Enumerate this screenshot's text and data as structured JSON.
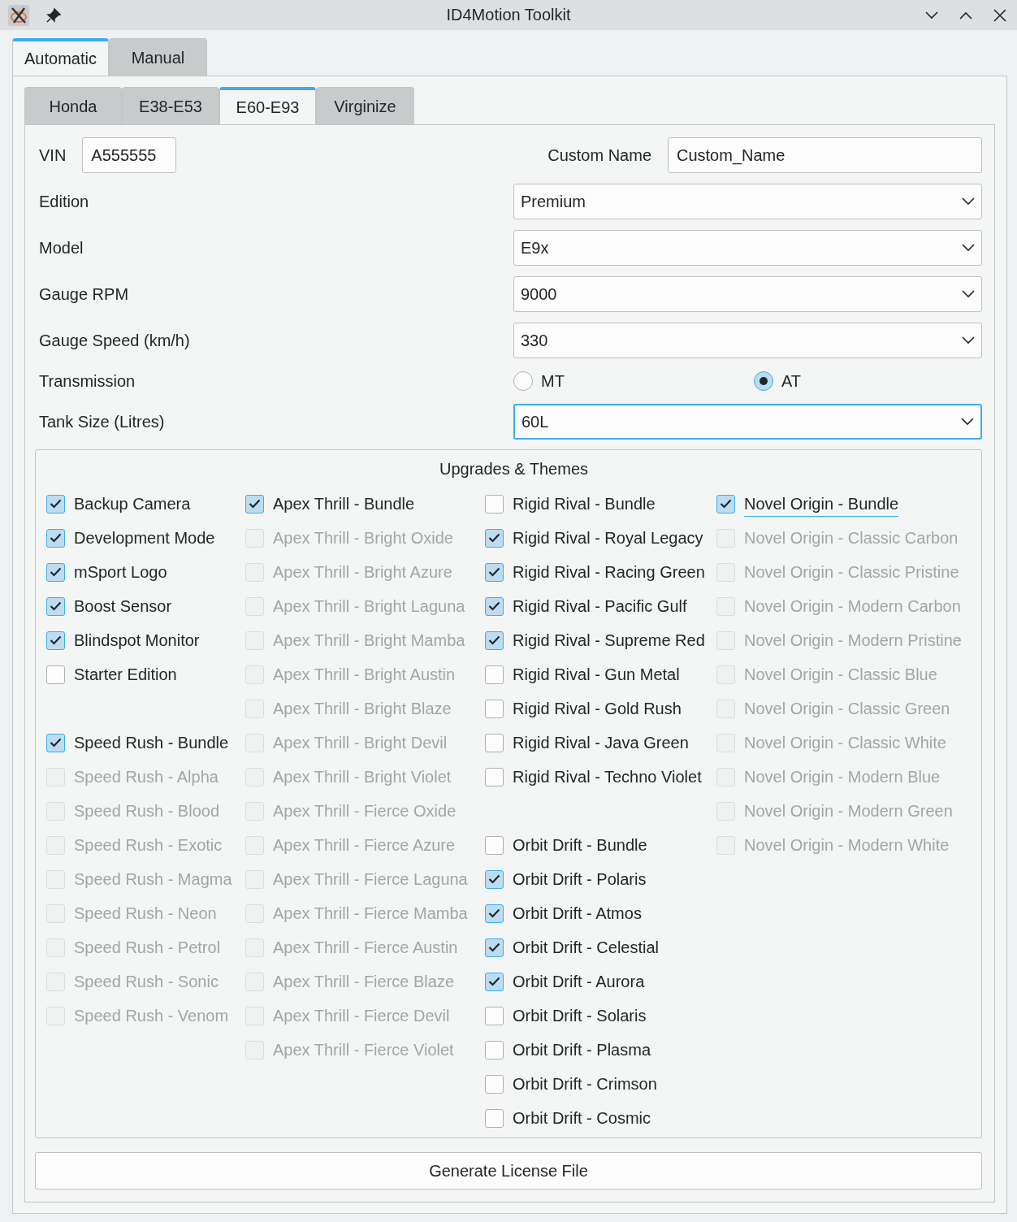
{
  "window": {
    "title": "ID4Motion Toolkit"
  },
  "top_tabs": [
    {
      "label": "Automatic",
      "selected": true
    },
    {
      "label": "Manual",
      "selected": false
    }
  ],
  "sub_tabs": [
    {
      "label": "Honda",
      "selected": false
    },
    {
      "label": "E38-E53",
      "selected": false
    },
    {
      "label": "E60-E93",
      "selected": true
    },
    {
      "label": "Virginize",
      "selected": false
    }
  ],
  "vin": {
    "label": "VIN",
    "value": "A555555"
  },
  "custom_name": {
    "label": "Custom Name",
    "value": "Custom_Name"
  },
  "form_rows": [
    {
      "kind": "combo",
      "label": "Edition",
      "value": "Premium",
      "focused": false
    },
    {
      "kind": "combo",
      "label": "Model",
      "value": "E9x",
      "focused": false
    },
    {
      "kind": "combo",
      "label": "Gauge RPM",
      "value": "9000",
      "focused": false
    },
    {
      "kind": "combo",
      "label": "Gauge Speed (km/h)",
      "value": "330",
      "focused": false
    },
    {
      "kind": "radio",
      "label": "Transmission",
      "options": [
        {
          "label": "MT",
          "selected": false
        },
        {
          "label": "AT",
          "selected": true
        }
      ]
    },
    {
      "kind": "combo",
      "label": "Tank Size (Litres)",
      "value": "60L",
      "focused": true
    }
  ],
  "upgrades": {
    "title": "Upgrades & Themes",
    "columns": [
      [
        {
          "kind": "checkbox",
          "label": "Backup Camera",
          "checked": true,
          "disabled": false
        },
        {
          "kind": "checkbox",
          "label": "Development Mode",
          "checked": true,
          "disabled": false
        },
        {
          "kind": "checkbox",
          "label": "mSport Logo",
          "checked": true,
          "disabled": false
        },
        {
          "kind": "checkbox",
          "label": "Boost Sensor",
          "checked": true,
          "disabled": false
        },
        {
          "kind": "checkbox",
          "label": "Blindspot Monitor",
          "checked": true,
          "disabled": false
        },
        {
          "kind": "checkbox",
          "label": "Starter Edition",
          "checked": false,
          "disabled": false
        },
        {
          "kind": "gap"
        },
        {
          "kind": "checkbox",
          "label": "Speed Rush - Bundle",
          "checked": true,
          "disabled": false
        },
        {
          "kind": "checkbox",
          "label": "Speed Rush - Alpha",
          "checked": false,
          "disabled": true
        },
        {
          "kind": "checkbox",
          "label": "Speed Rush - Blood",
          "checked": false,
          "disabled": true
        },
        {
          "kind": "checkbox",
          "label": "Speed Rush - Exotic",
          "checked": false,
          "disabled": true
        },
        {
          "kind": "checkbox",
          "label": "Speed Rush - Magma",
          "checked": false,
          "disabled": true
        },
        {
          "kind": "checkbox",
          "label": "Speed Rush - Neon",
          "checked": false,
          "disabled": true
        },
        {
          "kind": "checkbox",
          "label": "Speed Rush - Petrol",
          "checked": false,
          "disabled": true
        },
        {
          "kind": "checkbox",
          "label": "Speed Rush - Sonic",
          "checked": false,
          "disabled": true
        },
        {
          "kind": "checkbox",
          "label": "Speed Rush - Venom",
          "checked": false,
          "disabled": true
        }
      ],
      [
        {
          "kind": "checkbox",
          "label": "Apex Thrill - Bundle",
          "checked": true,
          "disabled": false
        },
        {
          "kind": "checkbox",
          "label": "Apex Thrill - Bright Oxide",
          "checked": false,
          "disabled": true
        },
        {
          "kind": "checkbox",
          "label": "Apex Thrill - Bright Azure",
          "checked": false,
          "disabled": true
        },
        {
          "kind": "checkbox",
          "label": "Apex Thrill - Bright Laguna",
          "checked": false,
          "disabled": true
        },
        {
          "kind": "checkbox",
          "label": "Apex Thrill - Bright Mamba",
          "checked": false,
          "disabled": true
        },
        {
          "kind": "checkbox",
          "label": "Apex Thrill - Bright Austin",
          "checked": false,
          "disabled": true
        },
        {
          "kind": "checkbox",
          "label": "Apex Thrill - Bright Blaze",
          "checked": false,
          "disabled": true
        },
        {
          "kind": "checkbox",
          "label": "Apex Thrill - Bright Devil",
          "checked": false,
          "disabled": true
        },
        {
          "kind": "checkbox",
          "label": "Apex Thrill - Bright Violet",
          "checked": false,
          "disabled": true
        },
        {
          "kind": "checkbox",
          "label": "Apex Thrill - Fierce Oxide",
          "checked": false,
          "disabled": true
        },
        {
          "kind": "checkbox",
          "label": "Apex Thrill - Fierce Azure",
          "checked": false,
          "disabled": true
        },
        {
          "kind": "checkbox",
          "label": "Apex Thrill - Fierce Laguna",
          "checked": false,
          "disabled": true
        },
        {
          "kind": "checkbox",
          "label": "Apex Thrill - Fierce Mamba",
          "checked": false,
          "disabled": true
        },
        {
          "kind": "checkbox",
          "label": "Apex Thrill - Fierce Austin",
          "checked": false,
          "disabled": true
        },
        {
          "kind": "checkbox",
          "label": "Apex Thrill - Fierce Blaze",
          "checked": false,
          "disabled": true
        },
        {
          "kind": "checkbox",
          "label": "Apex Thrill - Fierce Devil",
          "checked": false,
          "disabled": true
        },
        {
          "kind": "checkbox",
          "label": "Apex Thrill - Fierce Violet",
          "checked": false,
          "disabled": true
        }
      ],
      [
        {
          "kind": "checkbox",
          "label": "Rigid Rival - Bundle",
          "checked": false,
          "disabled": false
        },
        {
          "kind": "checkbox",
          "label": "Rigid Rival - Royal Legacy",
          "checked": true,
          "disabled": false
        },
        {
          "kind": "checkbox",
          "label": "Rigid Rival - Racing Green",
          "checked": true,
          "disabled": false
        },
        {
          "kind": "checkbox",
          "label": "Rigid Rival - Pacific Gulf",
          "checked": true,
          "disabled": false
        },
        {
          "kind": "checkbox",
          "label": "Rigid Rival - Supreme Red",
          "checked": true,
          "disabled": false
        },
        {
          "kind": "checkbox",
          "label": "Rigid Rival - Gun Metal",
          "checked": false,
          "disabled": false
        },
        {
          "kind": "checkbox",
          "label": "Rigid Rival - Gold Rush",
          "checked": false,
          "disabled": false
        },
        {
          "kind": "checkbox",
          "label": "Rigid Rival - Java Green",
          "checked": false,
          "disabled": false
        },
        {
          "kind": "checkbox",
          "label": "Rigid Rival - Techno Violet",
          "checked": false,
          "disabled": false
        },
        {
          "kind": "gap"
        },
        {
          "kind": "checkbox",
          "label": "Orbit Drift - Bundle",
          "checked": false,
          "disabled": false
        },
        {
          "kind": "checkbox",
          "label": "Orbit Drift - Polaris",
          "checked": true,
          "disabled": false
        },
        {
          "kind": "checkbox",
          "label": "Orbit Drift - Atmos",
          "checked": true,
          "disabled": false
        },
        {
          "kind": "checkbox",
          "label": "Orbit Drift - Celestial",
          "checked": true,
          "disabled": false
        },
        {
          "kind": "checkbox",
          "label": "Orbit Drift - Aurora",
          "checked": true,
          "disabled": false
        },
        {
          "kind": "checkbox",
          "label": "Orbit Drift - Solaris",
          "checked": false,
          "disabled": false
        },
        {
          "kind": "checkbox",
          "label": "Orbit Drift - Plasma",
          "checked": false,
          "disabled": false
        },
        {
          "kind": "checkbox",
          "label": "Orbit Drift - Crimson",
          "checked": false,
          "disabled": false
        },
        {
          "kind": "checkbox",
          "label": "Orbit Drift - Cosmic",
          "checked": false,
          "disabled": false
        }
      ],
      [
        {
          "kind": "checkbox",
          "label": "Novel Origin - Bundle",
          "checked": true,
          "disabled": false,
          "focused": true
        },
        {
          "kind": "checkbox",
          "label": "Novel Origin - Classic Carbon",
          "checked": false,
          "disabled": true
        },
        {
          "kind": "checkbox",
          "label": "Novel Origin - Classic Pristine",
          "checked": false,
          "disabled": true
        },
        {
          "kind": "checkbox",
          "label": "Novel Origin - Modern Carbon",
          "checked": false,
          "disabled": true
        },
        {
          "kind": "checkbox",
          "label": "Novel Origin - Modern Pristine",
          "checked": false,
          "disabled": true
        },
        {
          "kind": "checkbox",
          "label": "Novel Origin - Classic Blue",
          "checked": false,
          "disabled": true
        },
        {
          "kind": "checkbox",
          "label": "Novel Origin - Classic Green",
          "checked": false,
          "disabled": true
        },
        {
          "kind": "checkbox",
          "label": "Novel Origin - Classic White",
          "checked": false,
          "disabled": true
        },
        {
          "kind": "checkbox",
          "label": "Novel Origin - Modern Blue",
          "checked": false,
          "disabled": true
        },
        {
          "kind": "checkbox",
          "label": "Novel Origin - Modern Green",
          "checked": false,
          "disabled": true
        },
        {
          "kind": "checkbox",
          "label": "Novel Origin - Modern White",
          "checked": false,
          "disabled": true
        }
      ]
    ]
  },
  "generate_button": "Generate License File"
}
